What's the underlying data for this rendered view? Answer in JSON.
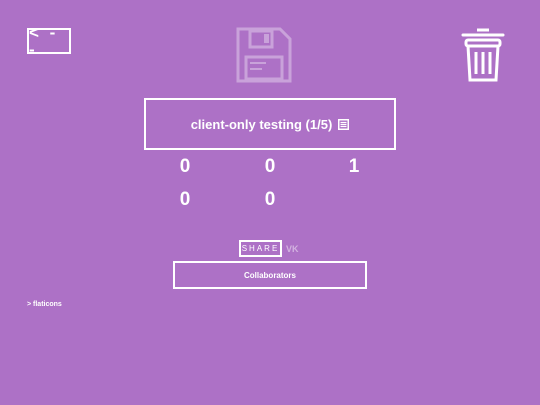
{
  "header": {
    "back_label": "< - -"
  },
  "title_box": {
    "title": "client-only testing (1/5)"
  },
  "counters": {
    "row1": [
      "0",
      "0",
      "1"
    ],
    "row2": [
      "0",
      "0"
    ]
  },
  "share": {
    "label": "SHARE",
    "vk_label": "VK"
  },
  "collaborators_label": "Collaborators",
  "footer": {
    "flaticons_label": "> flaticons"
  }
}
